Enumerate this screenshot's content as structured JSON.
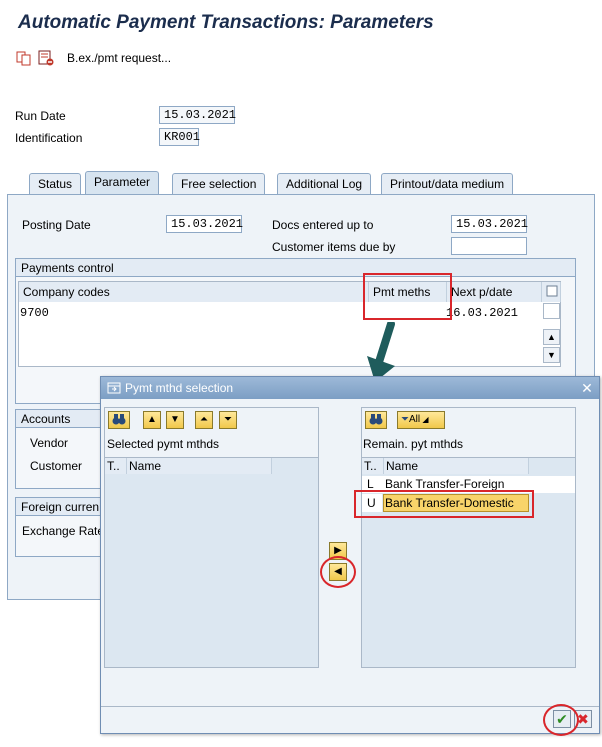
{
  "title": "Automatic Payment Transactions: Parameters",
  "toolbar": {
    "text": "B.ex./pmt request..."
  },
  "header": {
    "run_date_label": "Run Date",
    "run_date_value": "15.03.2021",
    "identification_label": "Identification",
    "identification_value": "KR001"
  },
  "tabs": [
    {
      "label": "Status"
    },
    {
      "label": "Parameter"
    },
    {
      "label": "Free selection"
    },
    {
      "label": "Additional Log"
    },
    {
      "label": "Printout/data medium"
    }
  ],
  "parameter": {
    "posting_date_label": "Posting Date",
    "posting_date_value": "15.03.2021",
    "docs_entered_label": "Docs entered up to",
    "docs_entered_value": "15.03.2021",
    "customer_due_label": "Customer items due by",
    "customer_due_value": "",
    "payments_control_label": "Payments control",
    "columns": [
      "Company codes",
      "Pmt meths",
      "Next p/date"
    ],
    "rows": [
      {
        "company_code": "9700",
        "pmt_meths": "",
        "next_date": "16.03.2021"
      }
    ],
    "accounts_label": "Accounts",
    "vendor_label": "Vendor",
    "customer_label": "Customer",
    "foreign_label": "Foreign curren",
    "exchange_label": "Exchange Rate"
  },
  "dialog": {
    "title": "Pymt mthd selection",
    "left_header": "Selected pymt mthds",
    "right_header": "Remain. pyt mthds",
    "col_t": "T..",
    "col_t_right": "T..",
    "col_name": "Name",
    "filter_all": "All",
    "remaining": [
      {
        "code": "L",
        "name": "Bank Transfer-Foreign"
      },
      {
        "code": "U",
        "name": "Bank Transfer-Domestic"
      }
    ]
  },
  "colors": {
    "title": "#1b2d4d",
    "accent_red": "#d9262b",
    "arrow": "#1f5c5c"
  }
}
